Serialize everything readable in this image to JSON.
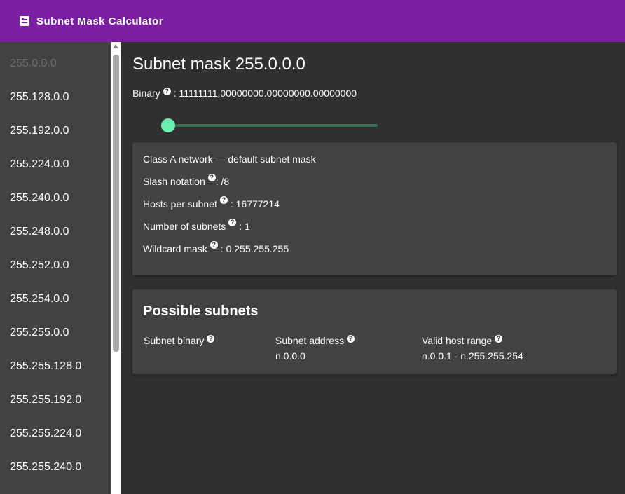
{
  "app": {
    "title": "Subnet Mask Calculator"
  },
  "sidebar": {
    "items": [
      {
        "label": "255.0.0.0"
      },
      {
        "label": "255.128.0.0"
      },
      {
        "label": "255.192.0.0"
      },
      {
        "label": "255.224.0.0"
      },
      {
        "label": "255.240.0.0"
      },
      {
        "label": "255.248.0.0"
      },
      {
        "label": "255.252.0.0"
      },
      {
        "label": "255.254.0.0"
      },
      {
        "label": "255.255.0.0"
      },
      {
        "label": "255.255.128.0"
      },
      {
        "label": "255.255.192.0"
      },
      {
        "label": "255.255.224.0"
      },
      {
        "label": "255.255.240.0"
      }
    ]
  },
  "main": {
    "heading": "Subnet mask 255.0.0.0",
    "binary_label": "Binary",
    "binary_value": ": 11111111.00000000.00000000.00000000",
    "slider": {
      "value": 8,
      "min": 8,
      "max": 32
    }
  },
  "info": {
    "class_text": "Class A network — default subnet mask",
    "slash_label": "Slash notation",
    "slash_value": ": /8",
    "hosts_label": "Hosts per subnet",
    "hosts_value": ": 16777214",
    "subnets_label": "Number of subnets",
    "subnets_value": ": 1",
    "wildcard_label": "Wildcard mask",
    "wildcard_value": ": 0.255.255.255"
  },
  "subnets": {
    "title": "Possible subnets",
    "columns": [
      {
        "header": "Subnet binary",
        "value": ""
      },
      {
        "header": "Subnet address",
        "value": "n.0.0.0"
      },
      {
        "header": "Valid host range",
        "value": "n.0.0.1 - n.255.255.254"
      }
    ]
  },
  "colors": {
    "appbar": "#7b1fa2",
    "accent": "#69f0ae",
    "background": "#303030",
    "card": "#424242"
  },
  "icons": {
    "app": "calculator-icon",
    "help": "help-circle-icon"
  }
}
